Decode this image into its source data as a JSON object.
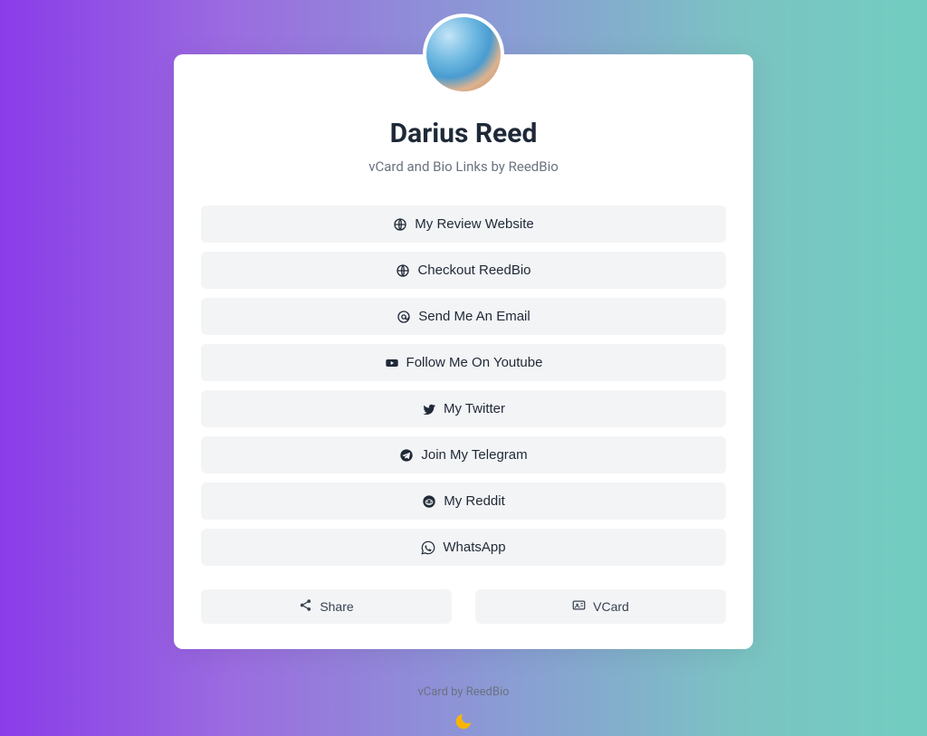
{
  "profile": {
    "name": "Darius Reed",
    "subtitle": "vCard and Bio Links by ReedBio"
  },
  "links": [
    {
      "icon": "globe",
      "label": "My Review Website"
    },
    {
      "icon": "globe",
      "label": "Checkout ReedBio"
    },
    {
      "icon": "at",
      "label": "Send Me An Email"
    },
    {
      "icon": "youtube",
      "label": "Follow Me On Youtube"
    },
    {
      "icon": "twitter",
      "label": "My Twitter"
    },
    {
      "icon": "telegram",
      "label": "Join My Telegram"
    },
    {
      "icon": "reddit",
      "label": "My Reddit"
    },
    {
      "icon": "whatsapp",
      "label": "WhatsApp"
    }
  ],
  "actions": {
    "share_label": "Share",
    "vcard_label": "VCard"
  },
  "footer": {
    "credit": "vCard by ReedBio"
  }
}
